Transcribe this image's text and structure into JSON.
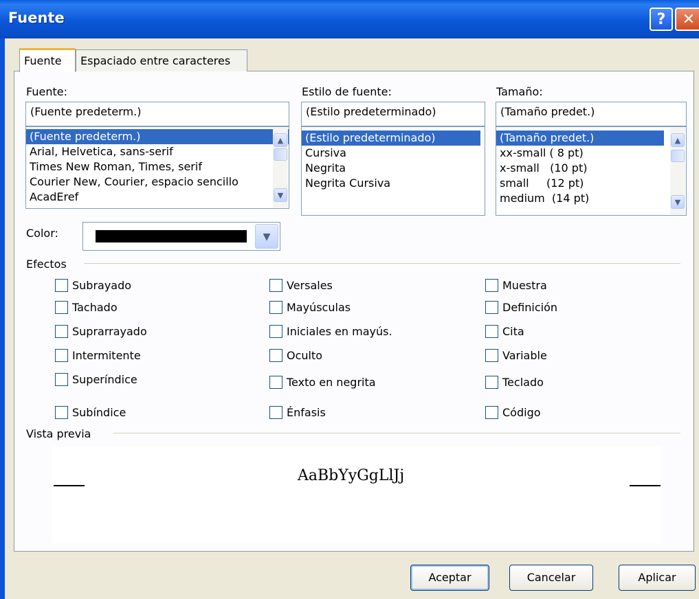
{
  "window": {
    "title": "Fuente",
    "help_label": "?",
    "close_label": "✕"
  },
  "tabs": [
    {
      "label": "Fuente",
      "active": true
    },
    {
      "label": "Espaciado entre caracteres",
      "active": false
    }
  ],
  "font": {
    "label": "Fuente:",
    "value": "(Fuente predeterm.)",
    "options": [
      "(Fuente predeterm.)",
      "Arial, Helvetica, sans-serif",
      "Times New Roman, Times, serif",
      "Courier New, Courier, espacio sencillo",
      "AcadEref"
    ]
  },
  "style": {
    "label": "Estilo de fuente:",
    "value": "(Estilo predeterminado)",
    "options": [
      "(Estilo predeterminado)",
      "Cursiva",
      "Negrita",
      "Negrita Cursiva"
    ]
  },
  "size": {
    "label": "Tamaño:",
    "value": "(Tamaño predet.)",
    "options": [
      "(Tamaño predet.)",
      "xx-small ( 8 pt)",
      "x-small   (10 pt)",
      "small     (12 pt)",
      "medium  (14 pt)"
    ]
  },
  "color": {
    "label": "Color:",
    "value": "#000000"
  },
  "effects": {
    "label": "Efectos",
    "col1": [
      "Subrayado",
      "Tachado",
      "Suprarrayado",
      "Intermitente",
      "Superíndice",
      "Subíndice"
    ],
    "col2": [
      "Versales",
      "Mayúsculas",
      "Iniciales en mayús.",
      "Oculto",
      "Texto en negrita",
      "Énfasis"
    ],
    "col3": [
      "Muestra",
      "Definición",
      "Cita",
      "Variable",
      "Teclado",
      "Código"
    ]
  },
  "preview": {
    "label": "Vista previa",
    "sample": "AaBbYyGgLlJj"
  },
  "buttons": {
    "ok": "Aceptar",
    "cancel": "Cancelar",
    "apply": "Aplicar"
  },
  "colors": {
    "titlebar": "#0b58d8",
    "selection": "#316ac5",
    "dialog_bg": "#ece9d8"
  }
}
